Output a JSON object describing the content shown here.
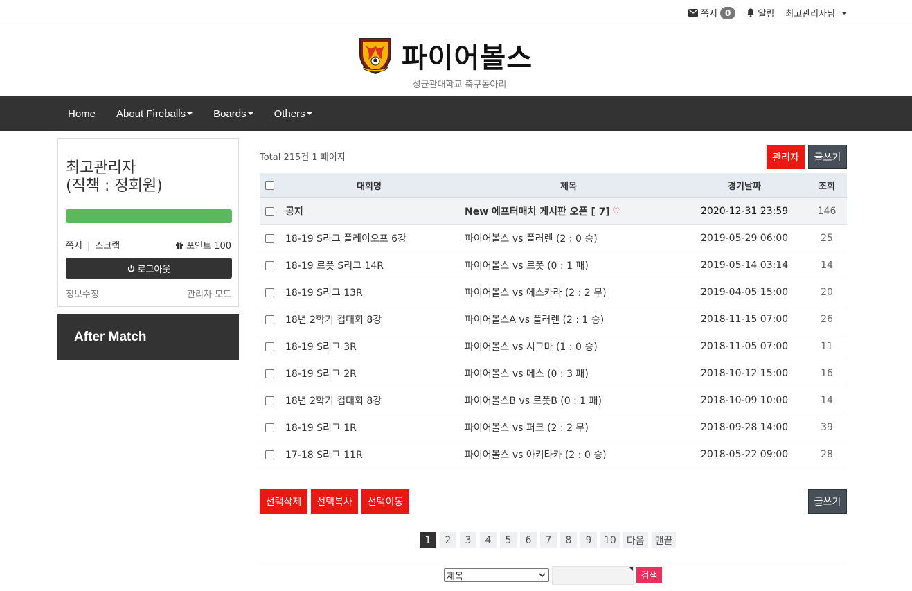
{
  "topbar": {
    "messages_label": "쪽지",
    "messages_count": "0",
    "alerts_label": "알림",
    "user_label": "최고관리자님"
  },
  "site": {
    "title": "파이어볼스",
    "subtitle": "성균관대학교 축구동아리"
  },
  "nav": {
    "items": [
      {
        "label": "Home"
      },
      {
        "label": "About Fireballs"
      },
      {
        "label": "Boards"
      },
      {
        "label": "Others"
      }
    ]
  },
  "profile": {
    "name_line1": "최고관리자",
    "name_line2": "(직책 : 정회원)",
    "link_message": "쪽지",
    "link_scrap": "스크랩",
    "points_label": "포인트 100",
    "logout_label": "로그아웃",
    "edit_info": "정보수정",
    "admin_mode": "관리자 모드",
    "progress": 1.0,
    "progress_color": "#5cb85c"
  },
  "sidebar": {
    "after_match": "After Match"
  },
  "board": {
    "total_text": "Total 215건 1 페이지",
    "admin_button": "관리자",
    "write_button": "글쓰기",
    "headers": {
      "competition": "대회명",
      "title": "제목",
      "date": "경기날짜",
      "views": "조회"
    },
    "rows": [
      {
        "competition": "공지",
        "title": "New 에프터매치 게시판 오픈 [ 7]",
        "date": "2020-12-31 23:59",
        "views": "146"
      },
      {
        "competition": "18-19 S리그 플레이오프 6강",
        "title": "파이어볼스 vs 플러렌 (2 : 0 승)",
        "date": "2019-05-29 06:00",
        "views": "25"
      },
      {
        "competition": "18-19 르폿 S리그 14R",
        "title": "파이어볼스 vs 르폿 (0 : 1 패)",
        "date": "2019-05-14 03:14",
        "views": "14"
      },
      {
        "competition": "18-19 S리그 13R",
        "title": "파이어볼스 vs 에스카라 (2 : 2 무)",
        "date": "2019-04-05 15:00",
        "views": "20"
      },
      {
        "competition": "18년 2학기 컵대회 8강",
        "title": "파이어볼스A vs 플러렌 (2 : 1 승)",
        "date": "2018-11-15 07:00",
        "views": "26"
      },
      {
        "competition": "18-19 S리그 3R",
        "title": "파이어볼스 vs 시그마 (1 : 0 승)",
        "date": "2018-11-05 07:00",
        "views": "11"
      },
      {
        "competition": "18-19 S리그 2R",
        "title": "파이어볼스 vs 메스 (0 : 3 패)",
        "date": "2018-10-12 15:00",
        "views": "16"
      },
      {
        "competition": "18년 2학기 컵대회 8강",
        "title": "파이어볼스B vs 르폿B (0 : 1 패)",
        "date": "2018-10-09 10:00",
        "views": "14"
      },
      {
        "competition": "18-19 S리그 1R",
        "title": "파이어볼스 vs 퍼크 (2 : 2 무)",
        "date": "2018-09-28 14:00",
        "views": "39"
      },
      {
        "competition": "17-18 S리그 11R",
        "title": "파이어볼스 vs 아키타카 (2 : 0 승)",
        "date": "2018-05-22 09:00",
        "views": "28"
      }
    ],
    "bulk_delete": "선택삭제",
    "bulk_copy": "선택복사",
    "bulk_move": "선택이동",
    "write_button_bottom": "글쓰기"
  },
  "pagination": {
    "pages": [
      "1",
      "2",
      "3",
      "4",
      "5",
      "6",
      "7",
      "8",
      "9",
      "10"
    ],
    "active": "1",
    "next": "다음",
    "last": "맨끝"
  },
  "search": {
    "select_value": "제목",
    "button": "검색"
  },
  "colors": {
    "accent_red": "#e61a12",
    "nav_bg": "#333333",
    "search_pink": "#ee2f5d"
  }
}
